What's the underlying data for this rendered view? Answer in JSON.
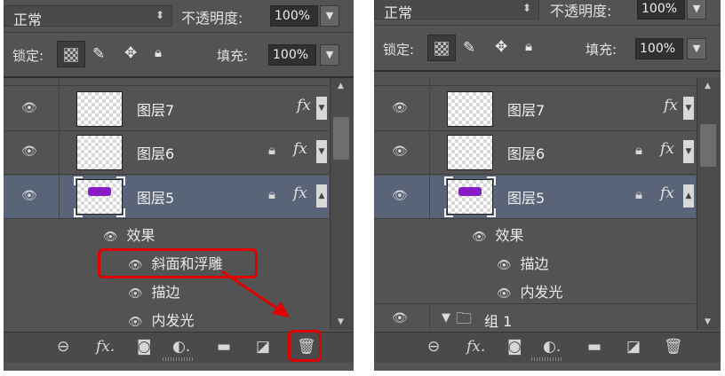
{
  "panelA": {
    "blend_mode": "正常",
    "opacity_label": "不透明度:",
    "opacity_value": "100%",
    "lock_label": "锁定:",
    "fill_label": "填充:",
    "fill_value": "100%",
    "layers": [
      {
        "name": "图层7",
        "locked": false,
        "fx": true,
        "selected": false
      },
      {
        "name": "图层6",
        "locked": true,
        "fx": true,
        "selected": false
      },
      {
        "name": "图层5",
        "locked": true,
        "fx": true,
        "selected": true
      }
    ],
    "effects_header": "效果",
    "effects": [
      "斜面和浮雕",
      "描边",
      "内发光"
    ],
    "highlighted_effect": "斜面和浮雕",
    "highlighted_button": "delete-layer-button",
    "highlight_color": "#e00000"
  },
  "panelB": {
    "blend_mode": "正常",
    "opacity_label": "不透明度:",
    "opacity_value": "100%",
    "lock_label": "锁定:",
    "fill_label": "填充:",
    "fill_value": "100%",
    "layers": [
      {
        "name": "图层7",
        "locked": false,
        "fx": true,
        "selected": false
      },
      {
        "name": "图层6",
        "locked": true,
        "fx": true,
        "selected": false
      },
      {
        "name": "图层5",
        "locked": true,
        "fx": true,
        "selected": true
      }
    ],
    "effects_header": "效果",
    "effects": [
      "描边",
      "内发光"
    ],
    "group_name": "组 1"
  },
  "colors": {
    "panel_bg": "#535353",
    "selected_row": "#596479",
    "swatch_purple": "#8a1cc8"
  },
  "icons": {
    "fx": "fx",
    "visibility": "eye-icon",
    "lock": "lock-icon",
    "link": "link-icon",
    "mask": "mask-icon",
    "adjustment": "adjustment-icon",
    "folder": "folder-icon",
    "new_layer": "new-layer-icon",
    "trash": "trash-icon"
  }
}
